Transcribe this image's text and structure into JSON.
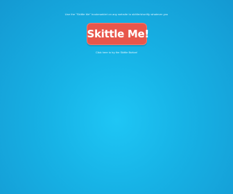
{
  "instruction_text": "Use the \"Skittle Me\" bookmarklet on any website to skittle/shortify whatever you",
  "cta_button_label": "Skittle Me!",
  "hint_text": "Click here to try the Skittle Button!",
  "colors": {
    "background": "#17b3e6",
    "button": "#e8564b",
    "text": "#dff6ff"
  }
}
